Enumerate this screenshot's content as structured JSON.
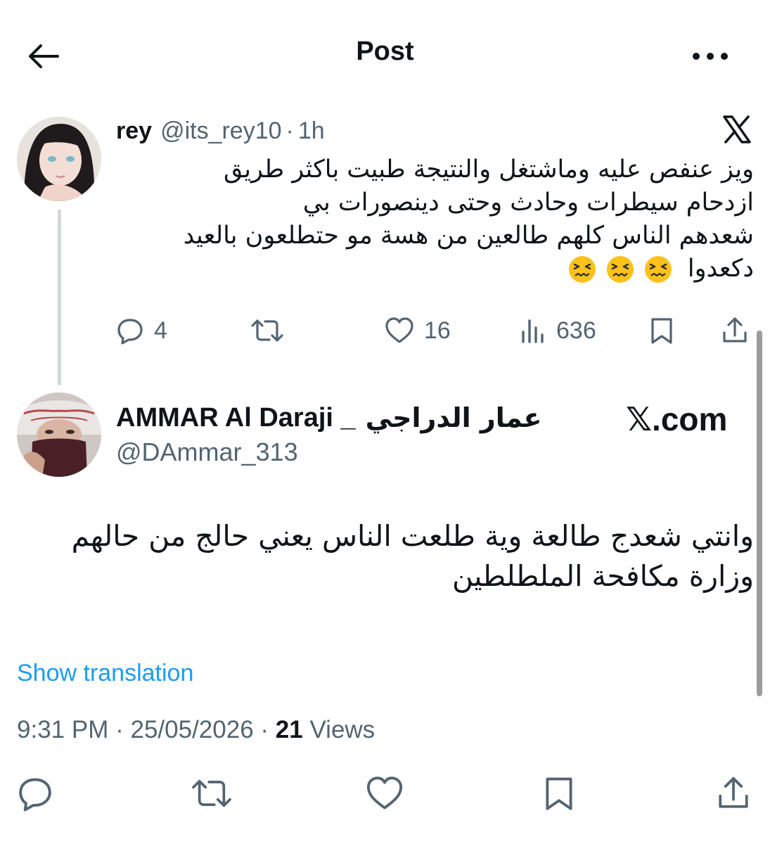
{
  "header": {
    "title": "Post",
    "back_icon": "arrow-left-icon",
    "more_icon": "more-horizontal-icon"
  },
  "parent_tweet": {
    "name": "rey",
    "handle": "@its_rey10",
    "separator": "·",
    "time": "1h",
    "text_lines": [
      "ويز عنفص عليه وماشتغل والنتيجة طبيت باكثر طريق",
      "ازدحام سيطرات وحادث وحتى دينصورات بي",
      "شعدهم الناس كلهم طالعين من هسة مو حتطلعون بالعيد",
      "دكعدوا"
    ],
    "emojis": [
      "confounded-face-emoji",
      "confounded-face-emoji",
      "confounded-face-emoji"
    ],
    "replies": "4",
    "likes": "16",
    "views": "636"
  },
  "main_tweet": {
    "name_latin": "AMMAR Al Daraji _",
    "name_arabic": "عمار الدراجي",
    "handle": "@DAmmar_313",
    "badge": "𝕏.com",
    "text_lines": [
      "وانتي شعدج طالعة وية طلعت الناس يعني حالج من حالهم",
      "وزارة مكافحة الملطلطين"
    ],
    "show_translation": "Show translation",
    "time": "9:31 PM",
    "separator": "·",
    "date": "25/05/2026",
    "views_count": "21",
    "views_label": "Views"
  },
  "colors": {
    "text": "#0f1419",
    "muted": "#536471",
    "link": "#1d9bf0",
    "thread_line": "#cfd9de"
  }
}
